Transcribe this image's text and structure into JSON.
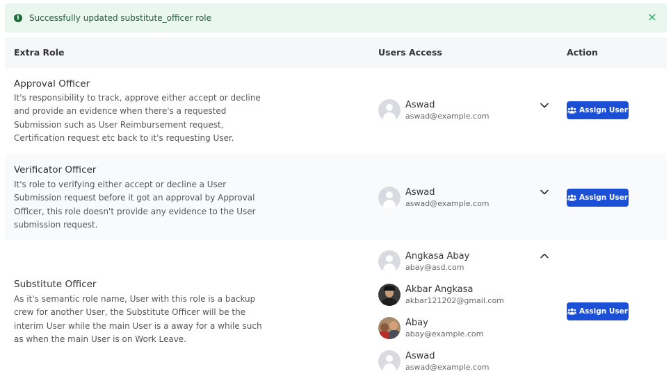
{
  "alert": {
    "message": "Successfully updated substitute_officer role",
    "info_glyph": "i",
    "close_glyph": "×"
  },
  "table": {
    "headers": {
      "extra_role": "Extra Role",
      "users_access": "Users Access",
      "action": "Action"
    }
  },
  "roles": [
    {
      "title": "Approval Officer",
      "description": "It's responsibility to track, approve either accept or decline and provide an evidence when there's a requested Submission such as User Reimbursement request, Certification request etc back to it's requesting User.",
      "users": [
        {
          "name": "Aswad",
          "email": "aswad@example.com"
        }
      ],
      "button_label": "Assign User"
    },
    {
      "title": "Verificator Officer",
      "description": "It's role to verifying either accept or decline a User Submission request before it got an approval by Approval Officer, this role doesn't provide any evidence to the User submission request.",
      "users": [
        {
          "name": "Aswad",
          "email": "aswad@example.com"
        }
      ],
      "button_label": "Assign User"
    },
    {
      "title": "Substitute Officer",
      "description": "As it's semantic role name, User with this role is a backup crew for another User, the Substitute Officer will be the interim User while the main User is a away for a while such as when the main User is on Work Leave.",
      "users": [
        {
          "name": "Angkasa Abay",
          "email": "abay@asd.com"
        },
        {
          "name": "Akbar Angkasa",
          "email": "akbar121202@gmail.com"
        },
        {
          "name": "Abay",
          "email": "abay@example.com"
        },
        {
          "name": "Aswad",
          "email": "aswad@example.com"
        }
      ],
      "button_label": "Assign User"
    }
  ],
  "colors": {
    "alert_bg": "#e9f7ee",
    "alert_text": "#1f5e36",
    "button_bg": "#1a4fd6",
    "header_bg": "#f6f7f9"
  }
}
